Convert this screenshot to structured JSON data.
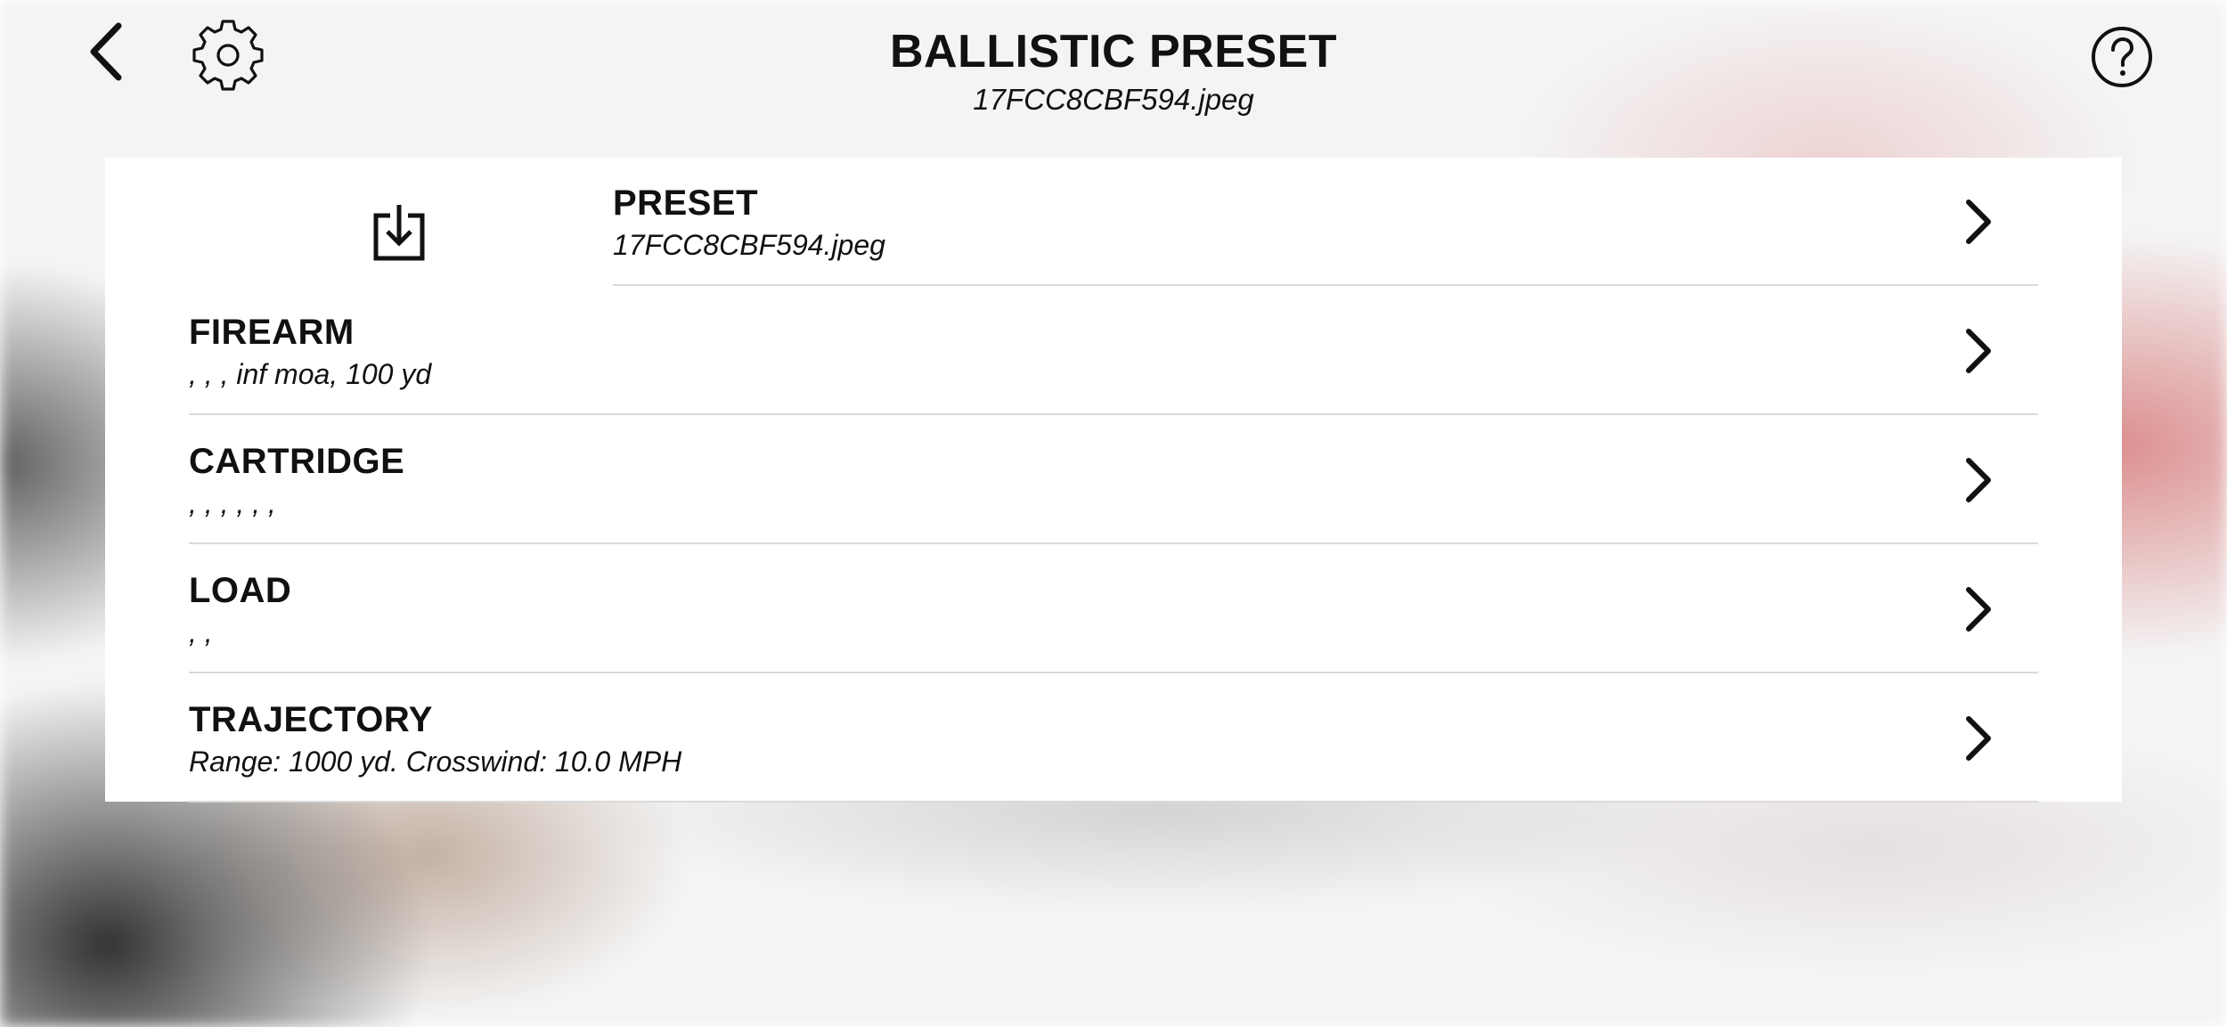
{
  "header": {
    "title": "BALLISTIC PRESET",
    "subtitle": "17FCC8CBF594.jpeg",
    "icons": {
      "back": "chevron-left-icon",
      "settings": "gear-icon",
      "help": "question-circle-icon"
    }
  },
  "list": {
    "download_icon": "download-tray-icon",
    "rows": [
      {
        "label": "PRESET",
        "detail": "17FCC8CBF594.jpeg"
      },
      {
        "label": "FIREARM",
        "detail": ", , , inf moa, 100 yd"
      },
      {
        "label": "CARTRIDGE",
        "detail": ", , , , , ,"
      },
      {
        "label": "LOAD",
        "detail": ", ,"
      },
      {
        "label": "TRAJECTORY",
        "detail": "Range: 1000 yd. Crosswind: 10.0 MPH"
      }
    ],
    "row_chevron_icon": "chevron-right-icon"
  }
}
